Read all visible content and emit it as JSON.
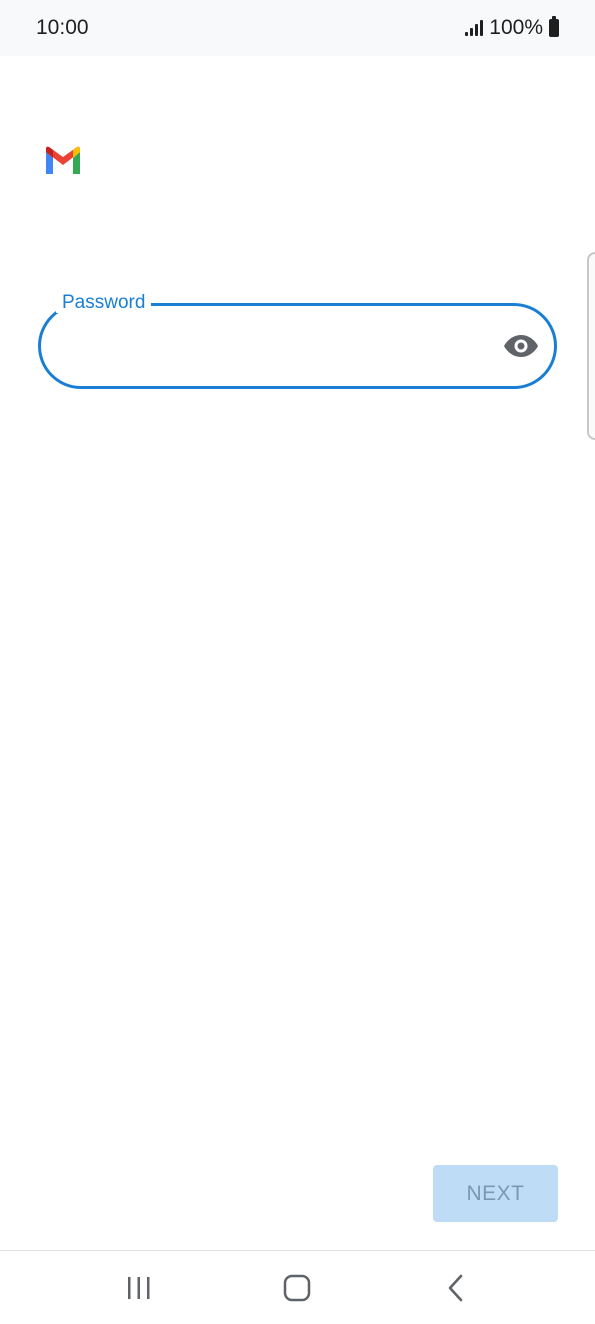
{
  "status_bar": {
    "time": "10:00",
    "battery_text": "100%",
    "icons": [
      "signal-icon",
      "battery-icon"
    ]
  },
  "app": {
    "logo_icon": "gmail-logo-icon"
  },
  "password_field": {
    "label": "Password",
    "value": "",
    "placeholder": "",
    "toggle_icon": "eye-icon",
    "accent_color": "#1a7fd4"
  },
  "actions": {
    "next_label": "NEXT",
    "next_disabled": true,
    "next_bg_color": "#bfdcf7"
  },
  "navigation_bar": {
    "icons": [
      "recent-apps-icon",
      "home-icon",
      "back-icon"
    ]
  }
}
